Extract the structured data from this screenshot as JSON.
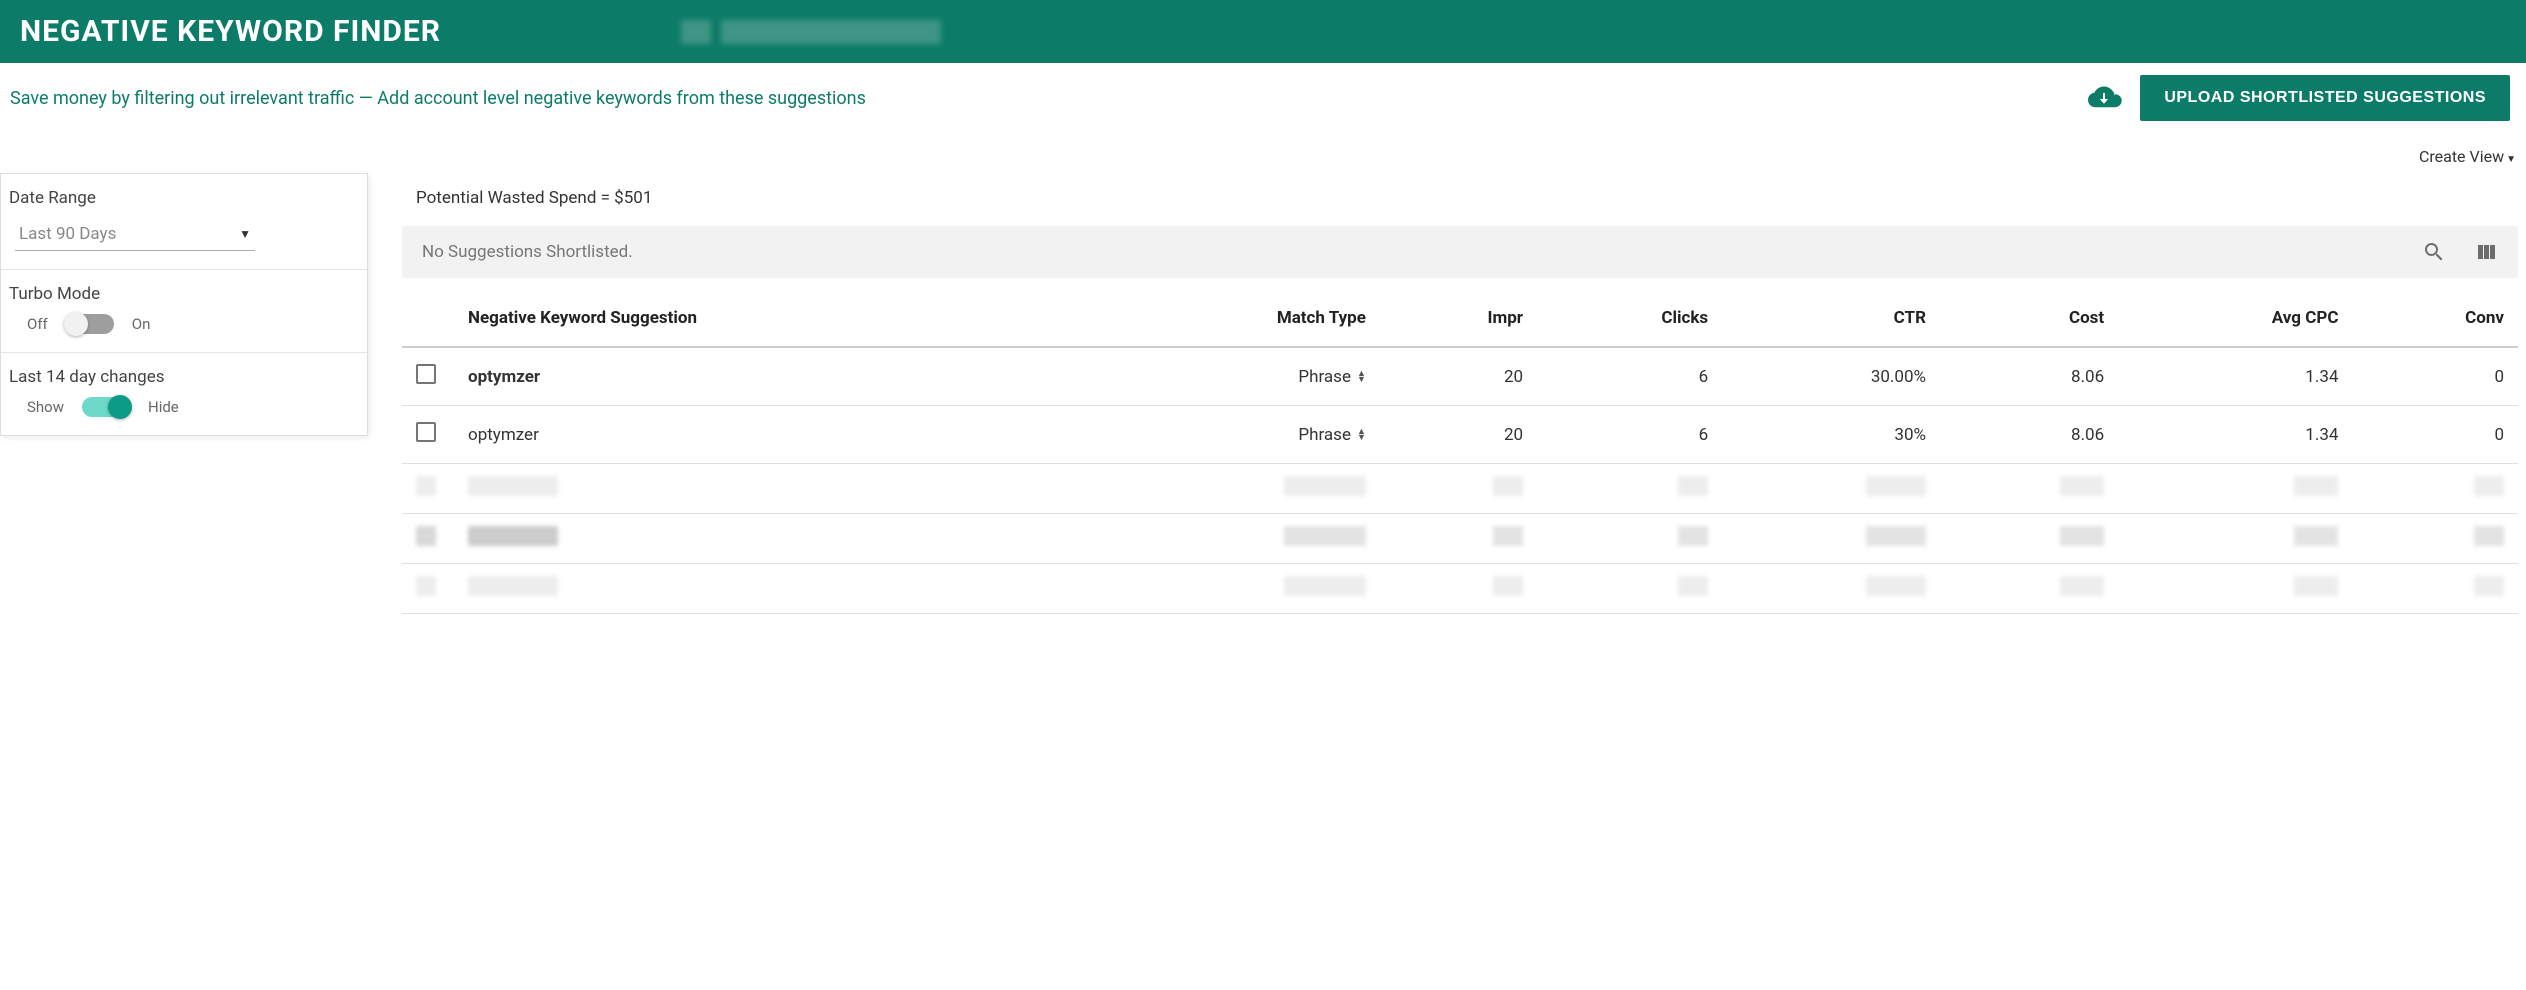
{
  "header": {
    "title": "NEGATIVE KEYWORD FINDER"
  },
  "subheader": {
    "tagline": "Save money by filtering out irrelevant traffic — Add account level negative keywords from these suggestions",
    "upload_btn": "UPLOAD SHORTLISTED SUGGESTIONS"
  },
  "sidebar": {
    "date_range_label": "Date Range",
    "date_range_value": "Last 90 Days",
    "turbo_label": "Turbo Mode",
    "turbo_off": "Off",
    "turbo_on": "On",
    "changes_label": "Last 14 day changes",
    "changes_show": "Show",
    "changes_hide": "Hide"
  },
  "main": {
    "create_view": "Create View",
    "wasted_spend": "Potential Wasted Spend = $501",
    "toolbar_text": "No Suggestions Shortlisted.",
    "columns": {
      "keyword": "Negative Keyword Suggestion",
      "match": "Match Type",
      "impr": "Impr",
      "clicks": "Clicks",
      "ctr": "CTR",
      "cost": "Cost",
      "avgcpc": "Avg CPC",
      "conv": "Conv"
    },
    "rows": [
      {
        "keyword": "optymzer",
        "bold": true,
        "match": "Phrase",
        "impr": "20",
        "clicks": "6",
        "ctr": "30.00%",
        "cost": "8.06",
        "avgcpc": "1.34",
        "conv": "0"
      },
      {
        "keyword": "optymzer",
        "bold": false,
        "match": "Phrase",
        "impr": "20",
        "clicks": "6",
        "ctr": "30%",
        "cost": "8.06",
        "avgcpc": "1.34",
        "conv": "0"
      }
    ]
  }
}
